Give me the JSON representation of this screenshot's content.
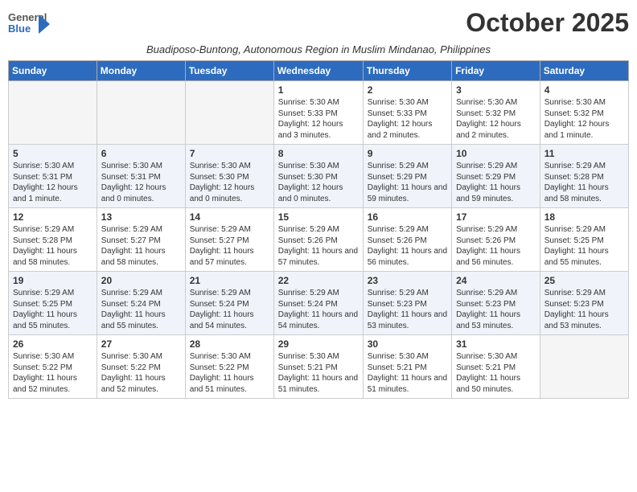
{
  "header": {
    "logo_general": "General",
    "logo_blue": "Blue",
    "month_title": "October 2025",
    "subtitle": "Buadiposo-Buntong, Autonomous Region in Muslim Mindanao, Philippines"
  },
  "days_of_week": [
    "Sunday",
    "Monday",
    "Tuesday",
    "Wednesday",
    "Thursday",
    "Friday",
    "Saturday"
  ],
  "weeks": [
    {
      "days": [
        {
          "num": "",
          "info": ""
        },
        {
          "num": "",
          "info": ""
        },
        {
          "num": "",
          "info": ""
        },
        {
          "num": "1",
          "info": "Sunrise: 5:30 AM\nSunset: 5:33 PM\nDaylight: 12 hours and 3 minutes."
        },
        {
          "num": "2",
          "info": "Sunrise: 5:30 AM\nSunset: 5:33 PM\nDaylight: 12 hours and 2 minutes."
        },
        {
          "num": "3",
          "info": "Sunrise: 5:30 AM\nSunset: 5:32 PM\nDaylight: 12 hours and 2 minutes."
        },
        {
          "num": "4",
          "info": "Sunrise: 5:30 AM\nSunset: 5:32 PM\nDaylight: 12 hours and 1 minute."
        }
      ]
    },
    {
      "days": [
        {
          "num": "5",
          "info": "Sunrise: 5:30 AM\nSunset: 5:31 PM\nDaylight: 12 hours and 1 minute."
        },
        {
          "num": "6",
          "info": "Sunrise: 5:30 AM\nSunset: 5:31 PM\nDaylight: 12 hours and 0 minutes."
        },
        {
          "num": "7",
          "info": "Sunrise: 5:30 AM\nSunset: 5:30 PM\nDaylight: 12 hours and 0 minutes."
        },
        {
          "num": "8",
          "info": "Sunrise: 5:30 AM\nSunset: 5:30 PM\nDaylight: 12 hours and 0 minutes."
        },
        {
          "num": "9",
          "info": "Sunrise: 5:29 AM\nSunset: 5:29 PM\nDaylight: 11 hours and 59 minutes."
        },
        {
          "num": "10",
          "info": "Sunrise: 5:29 AM\nSunset: 5:29 PM\nDaylight: 11 hours and 59 minutes."
        },
        {
          "num": "11",
          "info": "Sunrise: 5:29 AM\nSunset: 5:28 PM\nDaylight: 11 hours and 58 minutes."
        }
      ]
    },
    {
      "days": [
        {
          "num": "12",
          "info": "Sunrise: 5:29 AM\nSunset: 5:28 PM\nDaylight: 11 hours and 58 minutes."
        },
        {
          "num": "13",
          "info": "Sunrise: 5:29 AM\nSunset: 5:27 PM\nDaylight: 11 hours and 58 minutes."
        },
        {
          "num": "14",
          "info": "Sunrise: 5:29 AM\nSunset: 5:27 PM\nDaylight: 11 hours and 57 minutes."
        },
        {
          "num": "15",
          "info": "Sunrise: 5:29 AM\nSunset: 5:26 PM\nDaylight: 11 hours and 57 minutes."
        },
        {
          "num": "16",
          "info": "Sunrise: 5:29 AM\nSunset: 5:26 PM\nDaylight: 11 hours and 56 minutes."
        },
        {
          "num": "17",
          "info": "Sunrise: 5:29 AM\nSunset: 5:26 PM\nDaylight: 11 hours and 56 minutes."
        },
        {
          "num": "18",
          "info": "Sunrise: 5:29 AM\nSunset: 5:25 PM\nDaylight: 11 hours and 55 minutes."
        }
      ]
    },
    {
      "days": [
        {
          "num": "19",
          "info": "Sunrise: 5:29 AM\nSunset: 5:25 PM\nDaylight: 11 hours and 55 minutes."
        },
        {
          "num": "20",
          "info": "Sunrise: 5:29 AM\nSunset: 5:24 PM\nDaylight: 11 hours and 55 minutes."
        },
        {
          "num": "21",
          "info": "Sunrise: 5:29 AM\nSunset: 5:24 PM\nDaylight: 11 hours and 54 minutes."
        },
        {
          "num": "22",
          "info": "Sunrise: 5:29 AM\nSunset: 5:24 PM\nDaylight: 11 hours and 54 minutes."
        },
        {
          "num": "23",
          "info": "Sunrise: 5:29 AM\nSunset: 5:23 PM\nDaylight: 11 hours and 53 minutes."
        },
        {
          "num": "24",
          "info": "Sunrise: 5:29 AM\nSunset: 5:23 PM\nDaylight: 11 hours and 53 minutes."
        },
        {
          "num": "25",
          "info": "Sunrise: 5:29 AM\nSunset: 5:23 PM\nDaylight: 11 hours and 53 minutes."
        }
      ]
    },
    {
      "days": [
        {
          "num": "26",
          "info": "Sunrise: 5:30 AM\nSunset: 5:22 PM\nDaylight: 11 hours and 52 minutes."
        },
        {
          "num": "27",
          "info": "Sunrise: 5:30 AM\nSunset: 5:22 PM\nDaylight: 11 hours and 52 minutes."
        },
        {
          "num": "28",
          "info": "Sunrise: 5:30 AM\nSunset: 5:22 PM\nDaylight: 11 hours and 51 minutes."
        },
        {
          "num": "29",
          "info": "Sunrise: 5:30 AM\nSunset: 5:21 PM\nDaylight: 11 hours and 51 minutes."
        },
        {
          "num": "30",
          "info": "Sunrise: 5:30 AM\nSunset: 5:21 PM\nDaylight: 11 hours and 51 minutes."
        },
        {
          "num": "31",
          "info": "Sunrise: 5:30 AM\nSunset: 5:21 PM\nDaylight: 11 hours and 50 minutes."
        },
        {
          "num": "",
          "info": ""
        }
      ]
    }
  ]
}
